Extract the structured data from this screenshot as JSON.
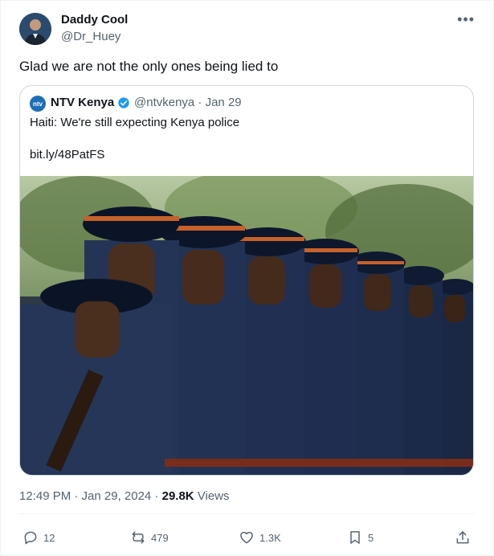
{
  "author": {
    "name": "Daddy Cool",
    "handle": "@Dr_Huey"
  },
  "tweet": {
    "text": "Glad we are not the only ones being lied to"
  },
  "quote": {
    "logo_text": "ntv",
    "name": "NTV Kenya",
    "meta": "@ntvkenya · Jan 29",
    "text": "Haiti: We're still expecting Kenya police",
    "link": "bit.ly/48PatFS"
  },
  "timestamp": {
    "time_date": "12:49 PM · Jan 29, 2024 · ",
    "views_count": "29.8K",
    "views_label": " Views"
  },
  "actions": {
    "replies": "12",
    "reposts": "479",
    "likes": "1.3K",
    "bookmarks": "5"
  },
  "colors": {
    "text_primary": "#0f1419",
    "text_secondary": "#536471",
    "verified_blue": "#1d9bf0",
    "ntv_blue": "#1c6fb6"
  }
}
